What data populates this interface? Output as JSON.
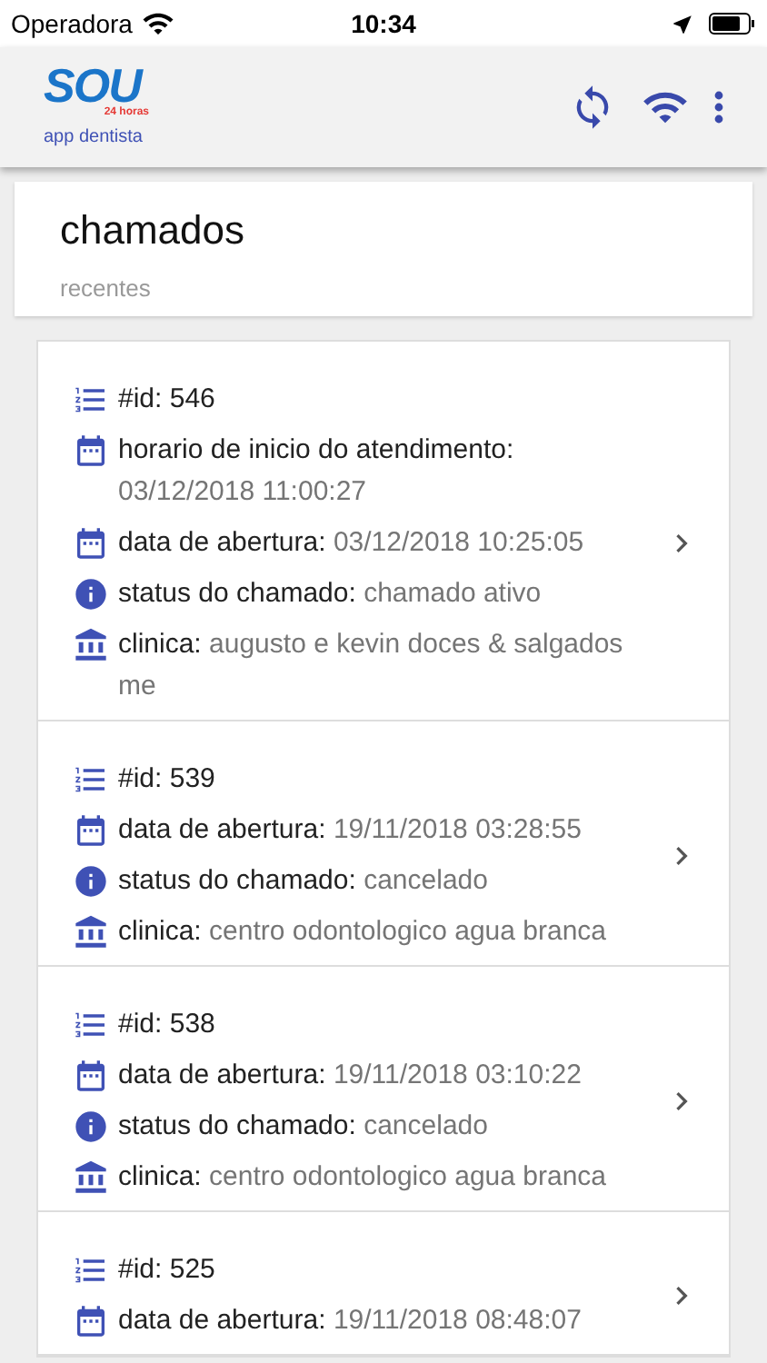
{
  "status_bar": {
    "carrier": "Operadora",
    "time": "10:34"
  },
  "header": {
    "logo": "SOU",
    "logo_tag": "24 horas",
    "subtitle": "app dentista"
  },
  "title_card": {
    "title": "chamados",
    "subtitle": "recentes"
  },
  "items": [
    {
      "fields": [
        {
          "kind": "id",
          "label": "#id:",
          "value": "546"
        },
        {
          "kind": "date",
          "label": "horario de inicio do atendimento:",
          "value": "03/12/2018 11:00:27"
        },
        {
          "kind": "date",
          "label": "data de abertura:",
          "value": "03/12/2018 10:25:05"
        },
        {
          "kind": "status",
          "label": "status do chamado:",
          "value": "chamado ativo"
        },
        {
          "kind": "clinic",
          "label": "clinica:",
          "value": "augusto e kevin doces & salgados me"
        }
      ]
    },
    {
      "fields": [
        {
          "kind": "id",
          "label": "#id:",
          "value": "539"
        },
        {
          "kind": "date",
          "label": "data de abertura:",
          "value": "19/11/2018 03:28:55"
        },
        {
          "kind": "status",
          "label": "status do chamado:",
          "value": "cancelado"
        },
        {
          "kind": "clinic",
          "label": "clinica:",
          "value": "centro odontologico agua branca"
        }
      ]
    },
    {
      "fields": [
        {
          "kind": "id",
          "label": "#id:",
          "value": "538"
        },
        {
          "kind": "date",
          "label": "data de abertura:",
          "value": "19/11/2018 03:10:22"
        },
        {
          "kind": "status",
          "label": "status do chamado:",
          "value": "cancelado"
        },
        {
          "kind": "clinic",
          "label": "clinica:",
          "value": "centro odontologico agua branca"
        }
      ]
    },
    {
      "fields": [
        {
          "kind": "id",
          "label": "#id:",
          "value": "525"
        },
        {
          "kind": "date",
          "label": "data de abertura:",
          "value": "19/11/2018 08:48:07"
        }
      ]
    }
  ]
}
